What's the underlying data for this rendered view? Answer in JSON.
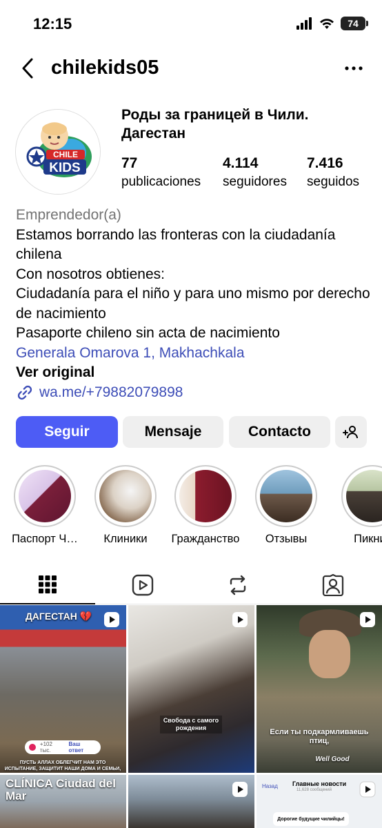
{
  "status_bar": {
    "time": "12:15",
    "battery": "74"
  },
  "header": {
    "username": "chilekids05"
  },
  "profile": {
    "display_name": "Роды за границей в Чили. Дагестан",
    "logo_line1": "CHILE",
    "logo_line2": "KIDS",
    "stats": [
      {
        "value": "77",
        "label": "publicaciones"
      },
      {
        "value": "4.114",
        "label": "seguidores"
      },
      {
        "value": "7.416",
        "label": "seguidos"
      }
    ]
  },
  "bio": {
    "category": "Emprendedor(a)",
    "lines": [
      "Estamos borrando las fronteras con la ciudadanía chilena",
      "Con nosotros obtienes:",
      "Ciudadanía para el niño y para uno mismo por derecho de nacimiento",
      "Pasaporte chileno sin acta de nacimiento"
    ],
    "location": "Generala Omarova 1, Makhachkala",
    "see_original": "Ver original",
    "link": "wa.me/+79882079898"
  },
  "actions": {
    "follow": "Seguir",
    "message": "Mensaje",
    "contact": "Contacto"
  },
  "highlights": [
    {
      "label": "Паспорт Ч…"
    },
    {
      "label": "Клиники"
    },
    {
      "label": "Гражданство"
    },
    {
      "label": "Отзывы"
    },
    {
      "label": "Пикник"
    }
  ],
  "posts": [
    {
      "caption_top": "ДАГЕСТАН 💔",
      "reply_label": "Ваш ответ",
      "count_text": "+102 тыс.",
      "caption_bottom": "ПУСТЬ АЛЛАХ ОБЛЕГЧИТ НАМ ЭТО ИСПЫТАНИЕ, ЗАЩИТИТ НАШИ ДОМА И СЕМЬИ,"
    },
    {
      "caption": "Свобода с самого рождения"
    },
    {
      "caption": "Если ты подкармливаешь птиц,",
      "brand": "Well Good"
    },
    {
      "caption": "CLÍNICA Ciudad del Mar"
    },
    {
      "caption": ""
    },
    {
      "back_label": "Назад",
      "title": "Главные новости",
      "subtitle": "11,628 сообщений",
      "message": "Дорогие будущие чилийцы!"
    }
  ],
  "colors": {
    "accent": "#4D5CF5",
    "link": "#3D4DB7",
    "muted": "#737373",
    "button_bg": "#EFEFEF"
  }
}
